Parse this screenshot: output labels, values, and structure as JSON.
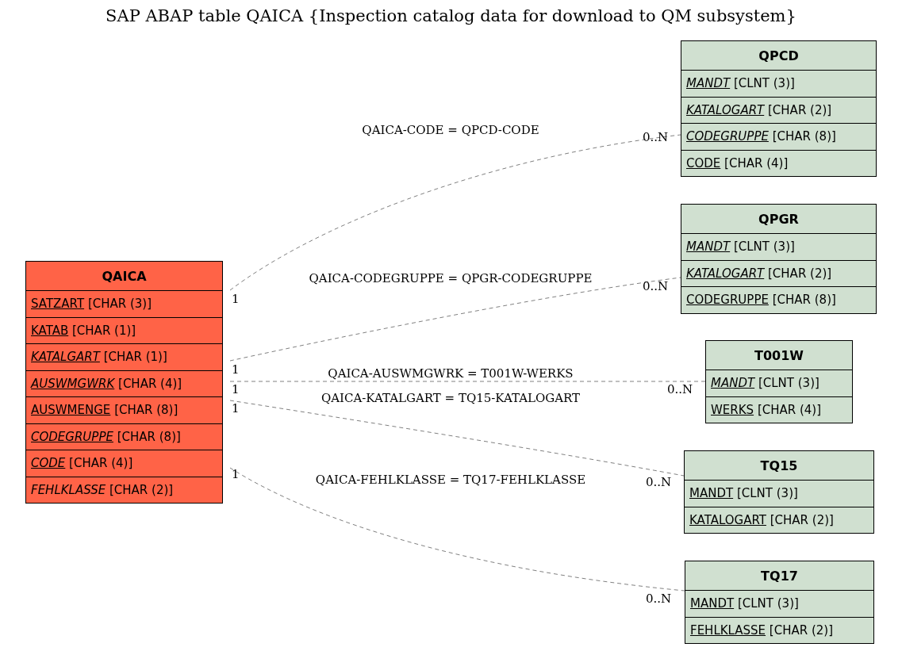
{
  "title": "SAP ABAP table QAICA {Inspection catalog data for download to QM subsystem}",
  "tables": [
    {
      "name": "QAICA",
      "kind": "main",
      "fields": [
        {
          "name": "SATZART",
          "type": "[CHAR (3)]",
          "key": true,
          "italic": false
        },
        {
          "name": "KATAB",
          "type": "[CHAR (1)]",
          "key": true,
          "italic": false
        },
        {
          "name": "KATALGART",
          "type": "[CHAR (1)]",
          "key": true,
          "italic": true
        },
        {
          "name": "AUSWMGWRK",
          "type": "[CHAR (4)]",
          "key": true,
          "italic": true
        },
        {
          "name": "AUSWMENGE",
          "type": "[CHAR (8)]",
          "key": true,
          "italic": false
        },
        {
          "name": "CODEGRUPPE",
          "type": "[CHAR (8)]",
          "key": true,
          "italic": true
        },
        {
          "name": "CODE",
          "type": "[CHAR (4)]",
          "key": true,
          "italic": true
        },
        {
          "name": "FEHLKLASSE",
          "type": "[CHAR (2)]",
          "key": false,
          "italic": true
        }
      ]
    },
    {
      "name": "QPCD",
      "kind": "related",
      "fields": [
        {
          "name": "MANDT",
          "type": "[CLNT (3)]",
          "key": true,
          "italic": true
        },
        {
          "name": "KATALOGART",
          "type": "[CHAR (2)]",
          "key": true,
          "italic": true
        },
        {
          "name": "CODEGRUPPE",
          "type": "[CHAR (8)]",
          "key": true,
          "italic": true
        },
        {
          "name": "CODE",
          "type": "[CHAR (4)]",
          "key": true,
          "italic": false
        }
      ]
    },
    {
      "name": "QPGR",
      "kind": "related",
      "fields": [
        {
          "name": "MANDT",
          "type": "[CLNT (3)]",
          "key": true,
          "italic": true
        },
        {
          "name": "KATALOGART",
          "type": "[CHAR (2)]",
          "key": true,
          "italic": true
        },
        {
          "name": "CODEGRUPPE",
          "type": "[CHAR (8)]",
          "key": true,
          "italic": false
        }
      ]
    },
    {
      "name": "T001W",
      "kind": "related",
      "fields": [
        {
          "name": "MANDT",
          "type": "[CLNT (3)]",
          "key": true,
          "italic": true
        },
        {
          "name": "WERKS",
          "type": "[CHAR (4)]",
          "key": true,
          "italic": false
        }
      ]
    },
    {
      "name": "TQ15",
      "kind": "related",
      "fields": [
        {
          "name": "MANDT",
          "type": "[CLNT (3)]",
          "key": true,
          "italic": false
        },
        {
          "name": "KATALOGART",
          "type": "[CHAR (2)]",
          "key": true,
          "italic": false
        }
      ]
    },
    {
      "name": "TQ17",
      "kind": "related",
      "fields": [
        {
          "name": "MANDT",
          "type": "[CLNT (3)]",
          "key": true,
          "italic": false
        },
        {
          "name": "FEHLKLASSE",
          "type": "[CHAR (2)]",
          "key": true,
          "italic": false
        }
      ]
    }
  ],
  "relations": [
    {
      "label": "QAICA-CODE = QPCD-CODE",
      "source_cardinality": "1",
      "target_cardinality": "0..N"
    },
    {
      "label": "QAICA-CODEGRUPPE = QPGR-CODEGRUPPE",
      "source_cardinality": "1",
      "target_cardinality": "0..N"
    },
    {
      "label": "QAICA-AUSWMGWRK = T001W-WERKS",
      "source_cardinality": "1",
      "target_cardinality": "0..N"
    },
    {
      "label": "QAICA-KATALGART = TQ15-KATALOGART",
      "source_cardinality": "1",
      "target_cardinality": "0..N"
    },
    {
      "label": "QAICA-FEHLKLASSE = TQ17-FEHLKLASSE",
      "source_cardinality": "1",
      "target_cardinality": "0..N"
    }
  ]
}
